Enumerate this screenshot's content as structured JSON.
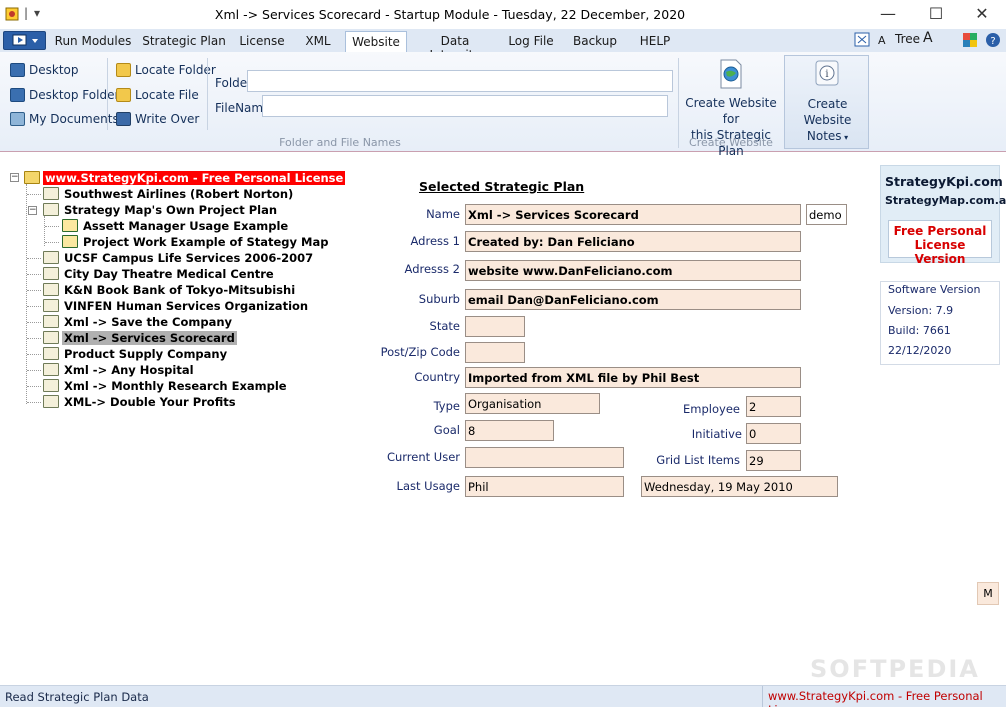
{
  "window": {
    "title": "Xml -> Services Scorecard  - Startup Module - Tuesday, 22 December, 2020",
    "controls": {
      "minimize": "—",
      "maximize": "☐",
      "close": "✕"
    }
  },
  "tabs": [
    {
      "label": "Run Modules",
      "active": false
    },
    {
      "label": "Strategic Plan",
      "active": false
    },
    {
      "label": "License",
      "active": false
    },
    {
      "label": "XML",
      "active": false
    },
    {
      "label": "Website",
      "active": true
    },
    {
      "label": "Data Integrity",
      "active": false
    },
    {
      "label": "Log File",
      "active": false
    },
    {
      "label": "Backup",
      "active": false
    },
    {
      "label": "HELP",
      "active": false
    }
  ],
  "ribbon_tools": {
    "font_small": "A",
    "tree": "Tree",
    "font_large": "A"
  },
  "ribbon": {
    "locations": {
      "desktop": "Desktop",
      "desktop_folder": "Desktop Folder",
      "my_documents": "My Documents"
    },
    "actions": {
      "locate_folder": "Locate Folder",
      "locate_file": "Locate File",
      "write_over": "Write Over"
    },
    "fields": {
      "folder_label": "Folder",
      "folder_value": "",
      "filename_label": "FileName",
      "filename_value": ""
    },
    "group_folder_label": "Folder and File Names",
    "create_website_line1": "Create Website for",
    "create_website_line2": "this Strategic Plan",
    "group_create_label": "Create Website",
    "create_notes_line1": "Create",
    "create_notes_line2": "Website Notes"
  },
  "tree": {
    "root": "www.StrategyKpi.com - Free Personal License",
    "items": [
      "Southwest Airlines (Robert Norton)",
      "Strategy Map's Own Project Plan",
      "Assett Manager Usage Example",
      "Project Work Example of Stategy Map",
      "UCSF Campus Life Services 2006-2007",
      "City Day Theatre Medical Centre",
      "K&N Book Bank of Tokyo-Mitsubishi",
      "VINFEN Human Services Organization",
      "Xml -> Save the Company",
      "Xml -> Services Scorecard",
      "Product Supply Company",
      "Xml -> Any Hospital",
      "Xml -> Monthly Research Example",
      "XML-> Double Your Profits"
    ],
    "selected_index": 9
  },
  "form": {
    "section_title": "Selected Strategic Plan",
    "name_label": "Name",
    "name": "Xml -> Services Scorecard",
    "code": "demo",
    "address1_label": "Adress 1",
    "address1": "Created by:  Dan Feliciano",
    "address2_label": "Adresss 2",
    "address2": "website  www.DanFeliciano.com",
    "suburb_label": "Suburb",
    "suburb": "email   Dan@DanFeliciano.com",
    "state_label": "State",
    "state": "",
    "postcode_label": "Post/Zip Code",
    "postcode": "",
    "country_label": "Country",
    "country": "Imported from XML file by Phil Best",
    "type_label": "Type",
    "type": "Organisation",
    "employee_label": "Employee",
    "employee": "2",
    "goal_label": "Goal",
    "goal": "8",
    "initiative_label": "Initiative",
    "initiative": "0",
    "current_user_label": "Current User",
    "current_user": "",
    "grid_items_label": "Grid List Items",
    "grid_items": "29",
    "last_usage_label": "Last Usage",
    "last_usage": "Phil",
    "last_usage_date": "Wednesday, 19 May 2010"
  },
  "side_panel": {
    "site1": "StrategyKpi.com",
    "site2": "StrategyMap.com.au",
    "license_line1": "Free Personal",
    "license_line2": "License Version",
    "software_version_label": "Software Version",
    "version": "Version: 7.9",
    "build": "Build: 7661",
    "date": "22/12/2020",
    "m_button": "M"
  },
  "status": {
    "left": "Read Strategic Plan Data",
    "right": "www.StrategyKpi.com - Free Personal License"
  },
  "watermark": "SOFTPEDIA"
}
